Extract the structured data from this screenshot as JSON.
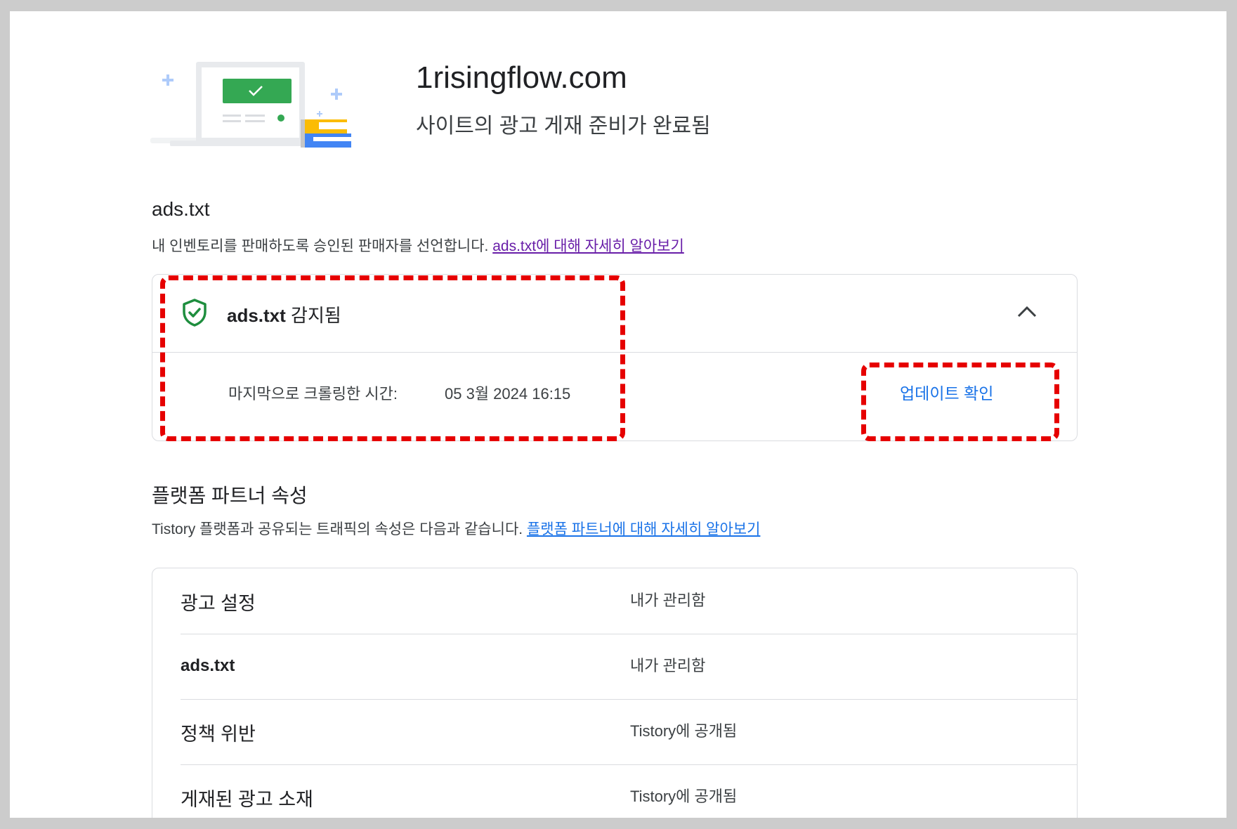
{
  "site": {
    "name": "1risingflow.com",
    "status": "사이트의 광고 게재 준비가 완료됨"
  },
  "ads_txt_section": {
    "title": "ads.txt",
    "description": "내 인벤토리를 판매하도록 승인된 판매자를 선언합니다.",
    "learn_more_link": "ads.txt에 대해 자세히 알아보기",
    "card": {
      "detected_prefix": "ads.txt",
      "detected_suffix": " 감지됨",
      "last_crawl_label": "마지막으로 크롤링한 시간:",
      "last_crawl_time": "05 3월 2024 16:15",
      "update_button": "업데이트 확인"
    }
  },
  "platform_section": {
    "title": "플랫폼 파트너 속성",
    "description": "Tistory 플랫폼과 공유되는 트래픽의 속성은 다음과 같습니다.",
    "learn_more_link": "플랫폼 파트너에 대해 자세히 알아보기",
    "rows": [
      {
        "name": "광고 설정",
        "value": "내가 관리함"
      },
      {
        "name": "ads.txt",
        "value": "내가 관리함"
      },
      {
        "name": "정책 위반",
        "value": "Tistory에 공개됨"
      },
      {
        "name": "게재된 광고 소재",
        "value": "Tistory에 공개됨"
      }
    ]
  },
  "colors": {
    "success_green": "#1e8e3e",
    "link_blue": "#1a73e8",
    "visited_purple": "#681da8",
    "highlight_red": "#e60000"
  }
}
